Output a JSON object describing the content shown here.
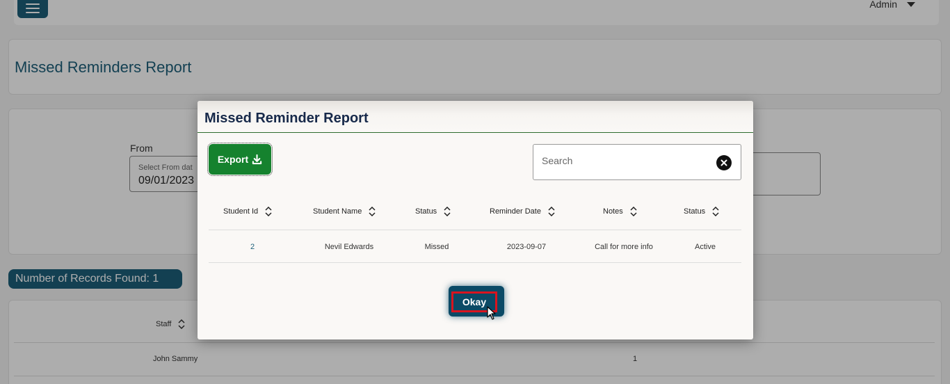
{
  "header": {
    "user_label": "Admin"
  },
  "page": {
    "title": "Missed Reminders Report"
  },
  "filters": {
    "from_label": "From",
    "from_placeholder": "Select From dat",
    "from_value": "09/01/2023"
  },
  "records": {
    "label": "Number of Records Found: 1"
  },
  "background_table": {
    "columns": [
      "Staff"
    ],
    "rows": [
      {
        "staff": "John Sammy",
        "count": "1"
      }
    ]
  },
  "modal": {
    "title": "Missed Reminder Report",
    "export_label": "Export",
    "search_placeholder": "Search",
    "columns": [
      "Student Id",
      "Student Name",
      "Status",
      "Reminder Date",
      "Notes",
      "Status"
    ],
    "rows": [
      {
        "student_id": "2",
        "student_name": "Nevil Edwards",
        "status": "Missed",
        "reminder_date": "2023-09-07",
        "notes": "Call for more info",
        "status2": "Active"
      }
    ],
    "okay_label": "Okay"
  },
  "colors": {
    "brand": "#1d5f7a",
    "export": "#15822e",
    "highlight": "#d9141f"
  },
  "icons": [
    "menu-icon",
    "caret-down-icon",
    "download-icon",
    "close-circle-icon",
    "sort-icon",
    "cursor-icon"
  ]
}
